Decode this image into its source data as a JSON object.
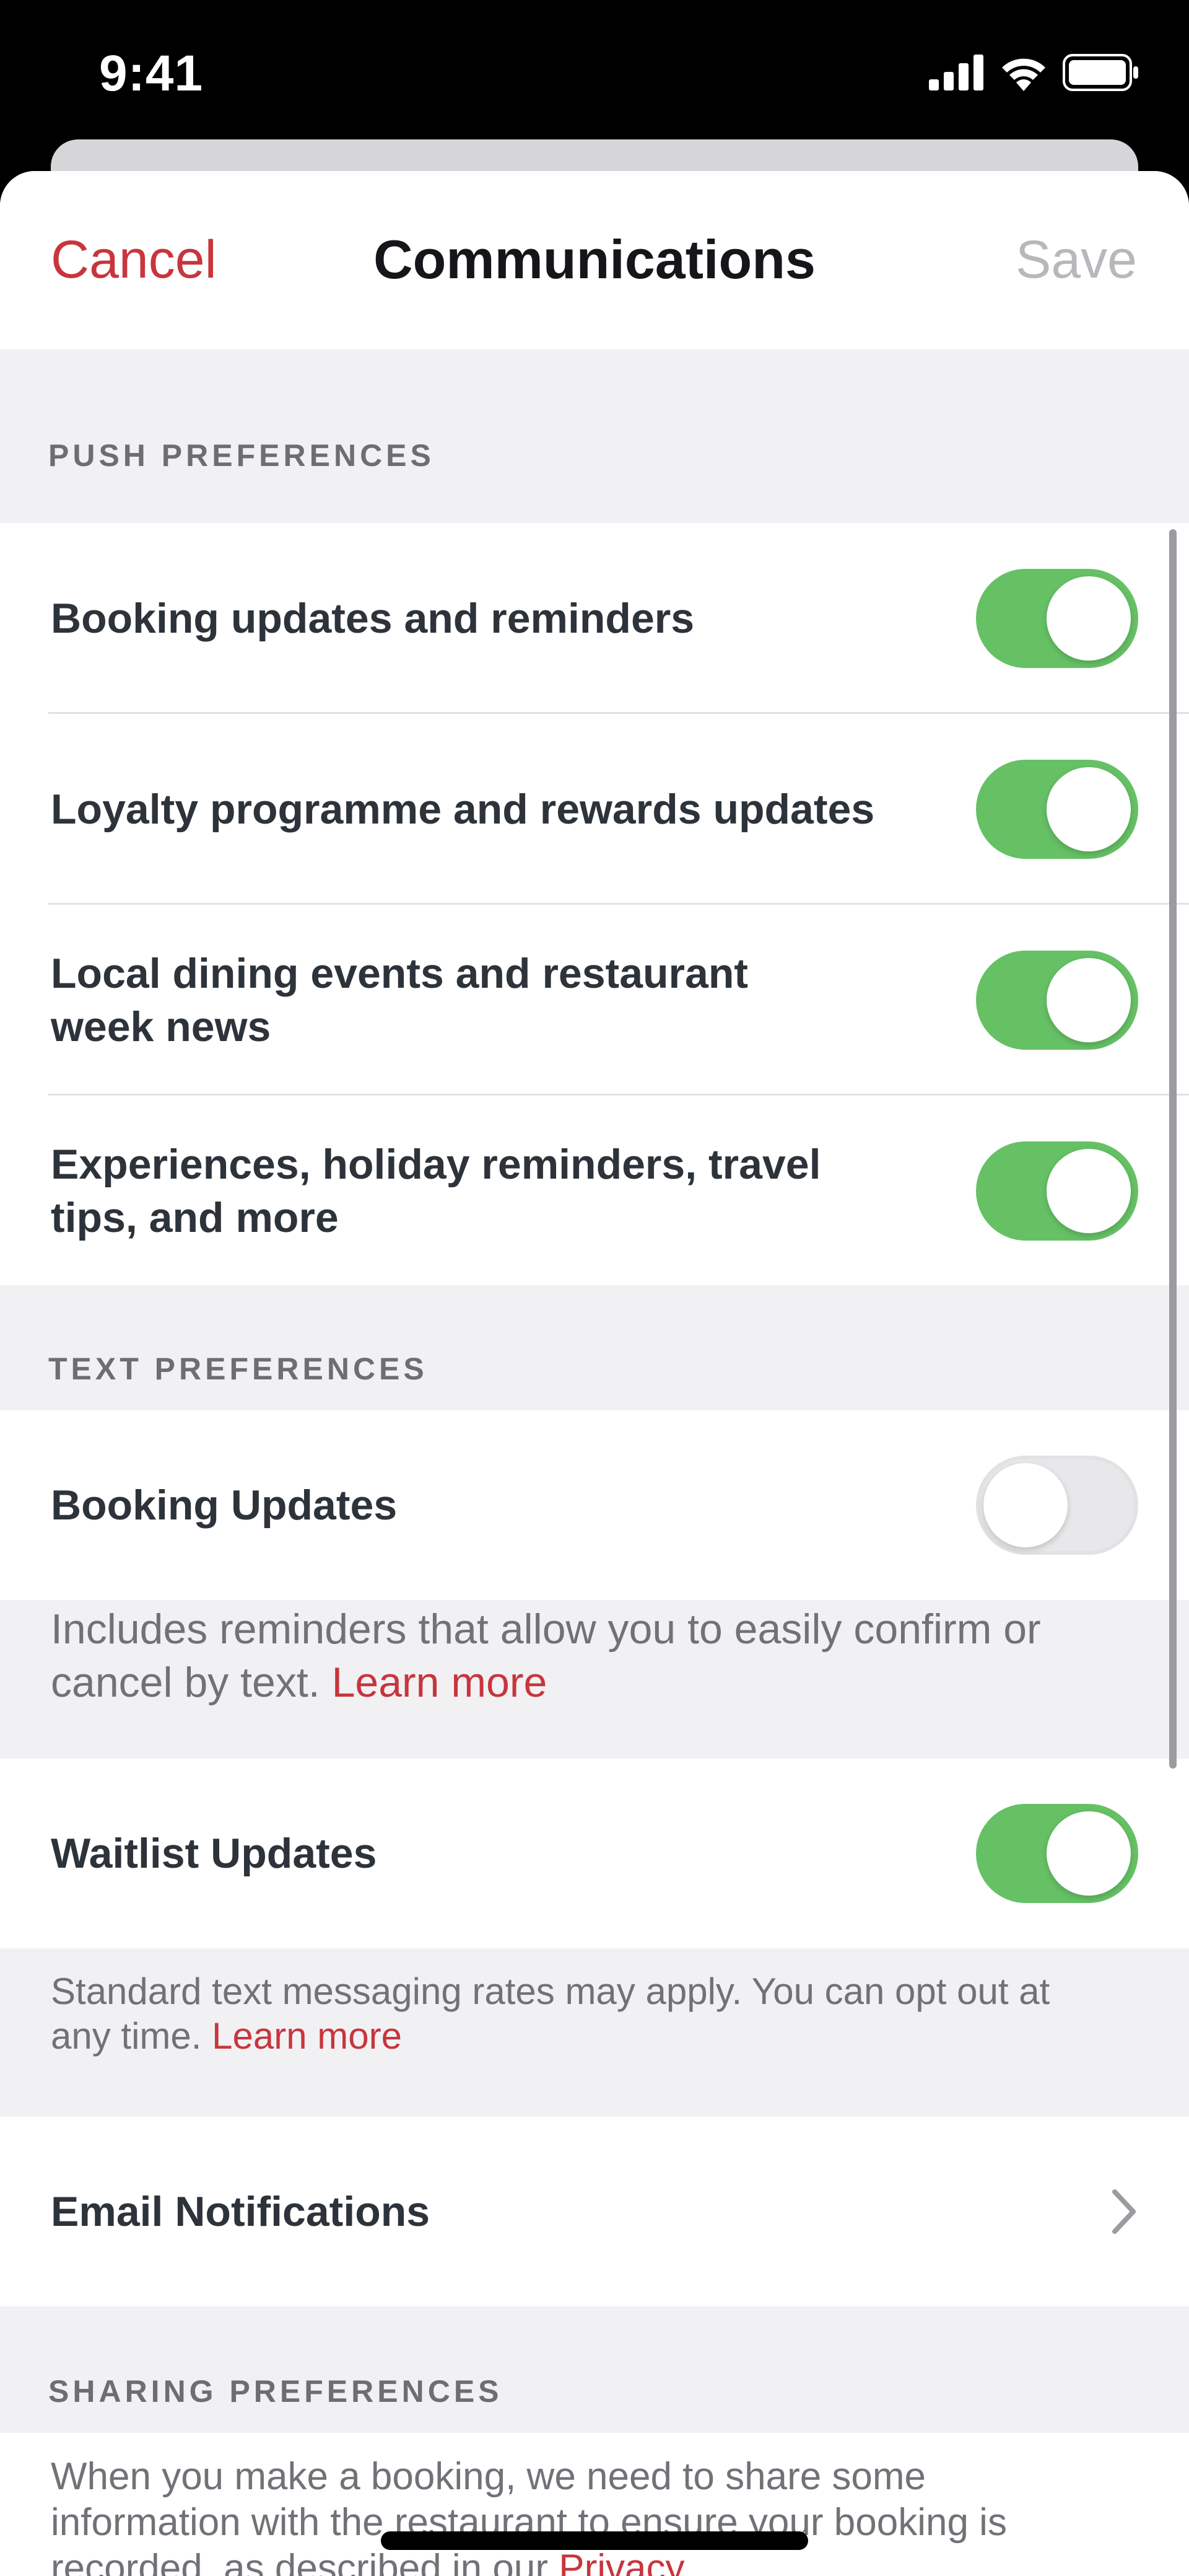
{
  "status_bar": {
    "time": "9:41",
    "icons": [
      "signal-icon",
      "wifi-icon",
      "battery-icon"
    ]
  },
  "nav": {
    "cancel_label": "Cancel",
    "title": "Communications",
    "save_label": "Save"
  },
  "push_preferences": {
    "header": "PUSH PREFERENCES",
    "items": [
      {
        "label": "Booking updates and reminders",
        "enabled": true
      },
      {
        "label": "Loyalty programme and rewards updates",
        "enabled": true
      },
      {
        "label": "Local dining events and restaurant week news",
        "enabled": true
      },
      {
        "label": "Experiences, holiday reminders, travel tips, and more",
        "enabled": true
      }
    ]
  },
  "text_preferences": {
    "header": "TEXT PREFERENCES",
    "booking_updates": {
      "label": "Booking Updates",
      "enabled": false,
      "note": "Includes reminders that allow you to easily confirm or cancel by text.",
      "note_link": "Learn more"
    },
    "waitlist_updates": {
      "label": "Waitlist Updates",
      "enabled": true,
      "note": "Standard text messaging rates may apply. You can opt out at any time.",
      "note_link": "Learn more"
    }
  },
  "email_notifications": {
    "label": "Email Notifications",
    "icon": "chevron-right-icon"
  },
  "sharing_preferences": {
    "header": "SHARING PREFERENCES",
    "text_before_link": "When you make a booking, we need to share some information with the restaurant to ensure your booking is recorded, as described in our",
    "link": "Privacy"
  },
  "colors": {
    "accent": "#c8353d",
    "toggle_on": "#66c165",
    "toggle_off": "#e8e8eb",
    "background": "#f1f1f3"
  }
}
